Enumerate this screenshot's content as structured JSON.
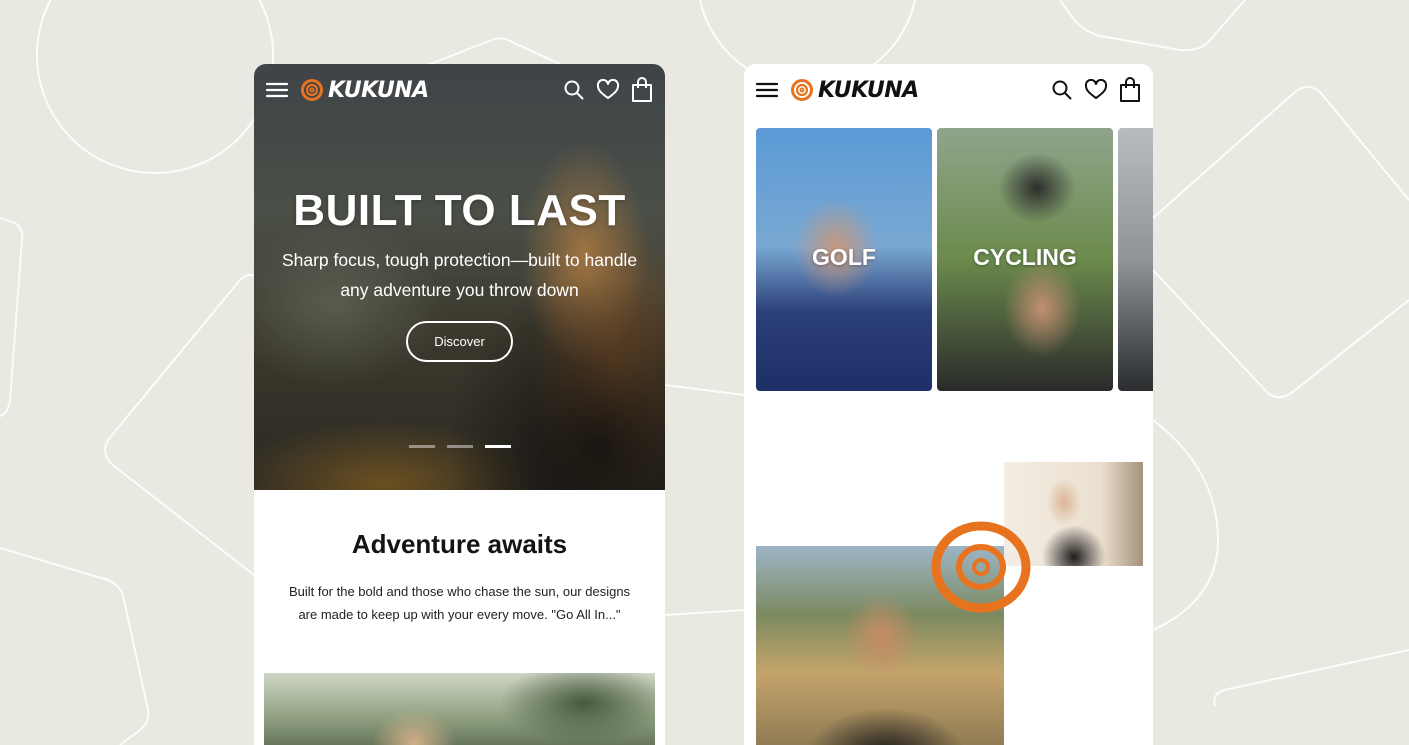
{
  "brand": {
    "name": "KUKUNA",
    "accent_color": "#e8731e"
  },
  "left_screen": {
    "nav": {
      "menu_icon": "hamburger-icon",
      "search_icon": "search-icon",
      "wishlist_icon": "heart-icon",
      "cart_icon": "bag-icon"
    },
    "hero": {
      "title": "BUILT TO LAST",
      "subtitle": "Sharp focus, tough protection—built to handle any adventure you throw down",
      "cta_label": "Discover",
      "slide_count": 3,
      "active_slide": 3
    },
    "section": {
      "title": "Adventure awaits",
      "body": "Built for the bold and those who chase the sun, our designs are made to keep up with your every move. \"Go All In...\""
    }
  },
  "right_screen": {
    "nav": {
      "menu_icon": "hamburger-icon",
      "search_icon": "search-icon",
      "wishlist_icon": "heart-icon",
      "cart_icon": "bag-icon"
    },
    "categories": [
      {
        "label": "GOLF"
      },
      {
        "label": "CYCLING"
      },
      {
        "label": ""
      }
    ]
  }
}
